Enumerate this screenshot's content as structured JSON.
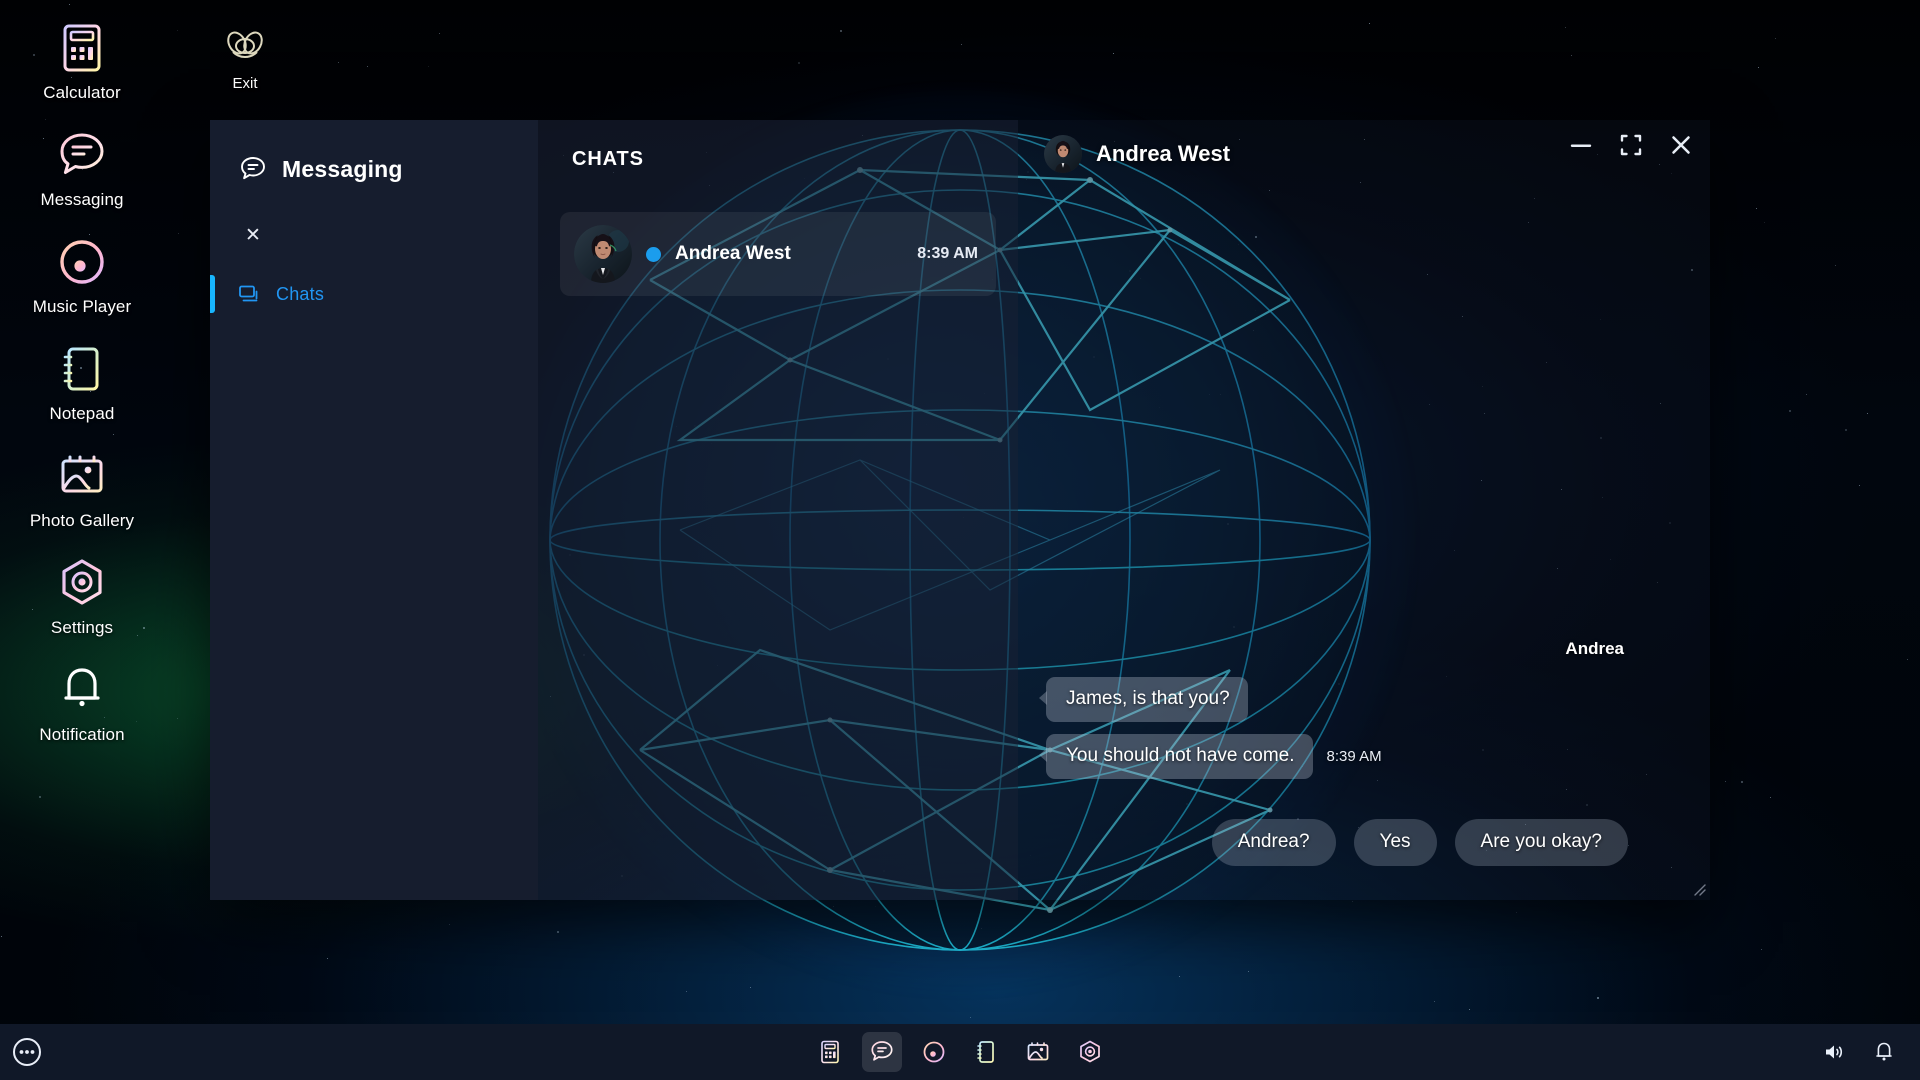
{
  "desktop": {
    "icons": [
      {
        "label": "Calculator",
        "icon": "calculator-icon"
      },
      {
        "label": "Messaging",
        "icon": "messaging-icon"
      },
      {
        "label": "Music Player",
        "icon": "music-player-icon"
      },
      {
        "label": "Notepad",
        "icon": "notepad-icon"
      },
      {
        "label": "Photo Gallery",
        "icon": "photo-gallery-icon"
      },
      {
        "label": "Settings",
        "icon": "settings-icon"
      },
      {
        "label": "Notification",
        "icon": "notification-icon"
      }
    ],
    "exit": {
      "label": "Exit",
      "icon": "exit-icon"
    }
  },
  "window": {
    "controls": {
      "minimize": "–",
      "maximize": "maximize-icon",
      "close": "✕"
    }
  },
  "sidebar": {
    "brand": "Messaging",
    "brand_icon": "chat-bubble-icon",
    "close_label": "✕",
    "items": [
      {
        "label": "Chats",
        "icon": "chats-icon",
        "active": true
      }
    ]
  },
  "chat_list": {
    "header": "CHATS",
    "rows": [
      {
        "name": "Andrea West",
        "time": "8:39 AM",
        "status": "online",
        "status_color": "#1b9ded",
        "selected": true
      }
    ]
  },
  "conversation": {
    "contact": "Andrea West",
    "sender_tag": "Andrea",
    "messages": [
      {
        "text": "James, is that you?",
        "time": "",
        "side": "left"
      },
      {
        "text": "You should not have come.",
        "time": "8:39 AM",
        "side": "left"
      }
    ],
    "suggestions": [
      "Andrea?",
      "Yes",
      "Are you okay?"
    ]
  },
  "taskbar": {
    "start": "start-menu-icon",
    "apps": [
      {
        "name": "Calculator",
        "icon": "calculator-icon",
        "active": false
      },
      {
        "name": "Messaging",
        "icon": "messaging-icon",
        "active": true
      },
      {
        "name": "Music Player",
        "icon": "music-player-icon",
        "active": false
      },
      {
        "name": "Notepad",
        "icon": "notepad-icon",
        "active": false
      },
      {
        "name": "Photo Gallery",
        "icon": "photo-gallery-icon",
        "active": false
      },
      {
        "name": "Settings",
        "icon": "settings-icon",
        "active": false
      }
    ],
    "tray": [
      {
        "name": "volume-icon"
      },
      {
        "name": "notification-bell-icon"
      }
    ]
  },
  "colors": {
    "accent": "#18b6ff",
    "nav_active_text": "#2196f3",
    "window_bg": "#161d2e",
    "taskbar_bg": "#101828",
    "online": "#1b9ded"
  }
}
